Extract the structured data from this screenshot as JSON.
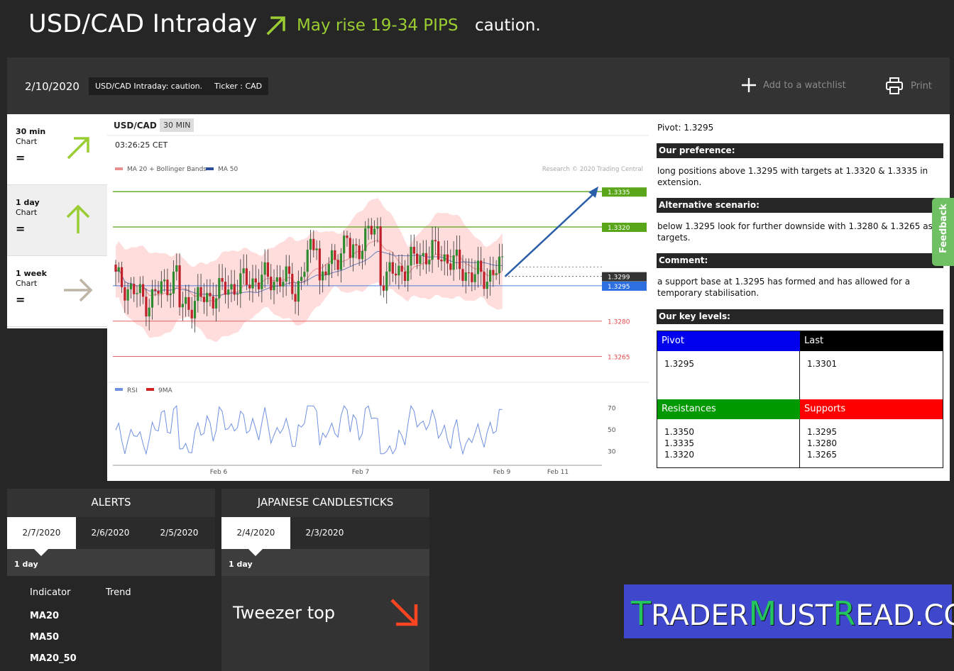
{
  "header": {
    "title": "USD/CAD Intraday",
    "forecast": "May rise 19-34 PIPS",
    "status": "caution."
  },
  "toolbar": {
    "date": "2/10/2020",
    "tags": [
      "USD/CAD Intraday: caution.",
      "Ticker : CAD"
    ],
    "watchlist_label": "Add to a watchlist",
    "print_label": "Print"
  },
  "timeframes": [
    {
      "label": "30 min",
      "sub": "Chart",
      "state": "=",
      "icon": "arrow-up-right-icon"
    },
    {
      "label": "1 day",
      "sub": "Chart",
      "state": "=",
      "icon": "arrow-up-icon"
    },
    {
      "label": "1 week",
      "sub": "Chart",
      "state": "=",
      "icon": "arrow-right-icon"
    }
  ],
  "chart": {
    "symbol": "USD/CAD",
    "interval": "30 MIN",
    "time": "03:26:25 CET",
    "legend_main": [
      "MA 20 + Bollinger Bands",
      "MA 50"
    ],
    "legend_rsi": [
      "RSI",
      "9MA"
    ],
    "watermark": "Research © 2020 Trading Central"
  },
  "chart_data": {
    "type": "candlestick",
    "symbol": "USD/CAD",
    "x_ticks": [
      "Feb 6",
      "Feb 7",
      "Feb 9",
      "Feb 11"
    ],
    "levels": [
      {
        "value": 1.3335,
        "label": "1.3335",
        "color": "#5aa61a"
      },
      {
        "value": 1.332,
        "label": "1.3320",
        "color": "#5aa61a"
      },
      {
        "value": 1.3299,
        "label": "1.3299",
        "color": "#333333"
      },
      {
        "value": 1.3295,
        "label": "1.3295",
        "color": "#2e6fe0"
      },
      {
        "value": 1.328,
        "label": "1.3280",
        "color": "#e04848"
      },
      {
        "value": 1.3265,
        "label": "1.3265",
        "color": "#e04848"
      }
    ],
    "ylim": [
      1.3257,
      1.3342
    ],
    "rsi_ticks": [
      70,
      50,
      30
    ],
    "rsi_ylim": [
      22,
      78
    ],
    "colors": {
      "up": "#2e8b2e",
      "down": "#c0202a",
      "band": "#ffd7d7",
      "ma20": "#e89090",
      "ma50": "#6a7fb8",
      "rsi": "#7090e0"
    }
  },
  "analysis": {
    "pivot": "Pivot: 1.3295",
    "preference_title": "Our preference:",
    "preference_text": "long positions above 1.3295 with targets at 1.3320 & 1.3335 in extension.",
    "alternative_title": "Alternative scenario:",
    "alternative_text": "below 1.3295 look for further downside with 1.3280 & 1.3265 as targets.",
    "comment_title": "Comment:",
    "comment_text": "a support base at 1.3295 has formed and has allowed for a temporary stabilisation.",
    "key_levels_title": "Our key levels:",
    "key_levels": {
      "pivot_label": "Pivot",
      "pivot_value": "1.3295",
      "last_label": "Last",
      "last_value": "1.3301",
      "resistances_label": "Resistances",
      "resistances": "1.3350\n1.3335\n1.3320",
      "supports_label": "Supports",
      "supports": "1.3295\n1.3280\n1.3265"
    }
  },
  "feedback_label": "Feedback",
  "alerts": {
    "title": "ALERTS",
    "tabs": [
      "2/7/2020",
      "2/6/2020",
      "2/5/2020"
    ],
    "period": "1 day",
    "col_indicator": "Indicator",
    "col_trend": "Trend",
    "rows": [
      "MA20",
      "MA50",
      "MA20_50"
    ]
  },
  "candlesticks": {
    "title": "JAPANESE CANDLESTICKS",
    "tabs": [
      "2/4/2020",
      "2/3/2020"
    ],
    "period": "1 day",
    "pattern": "Tweezer top"
  },
  "brand": {
    "parts": [
      {
        "text": "T",
        "hl": true
      },
      {
        "text": "RADER",
        "hl": false
      },
      {
        "text": "M",
        "hl": true
      },
      {
        "text": "UST",
        "hl": false
      },
      {
        "text": "R",
        "hl": true
      },
      {
        "text": "EAD.COM",
        "hl": false
      }
    ]
  }
}
